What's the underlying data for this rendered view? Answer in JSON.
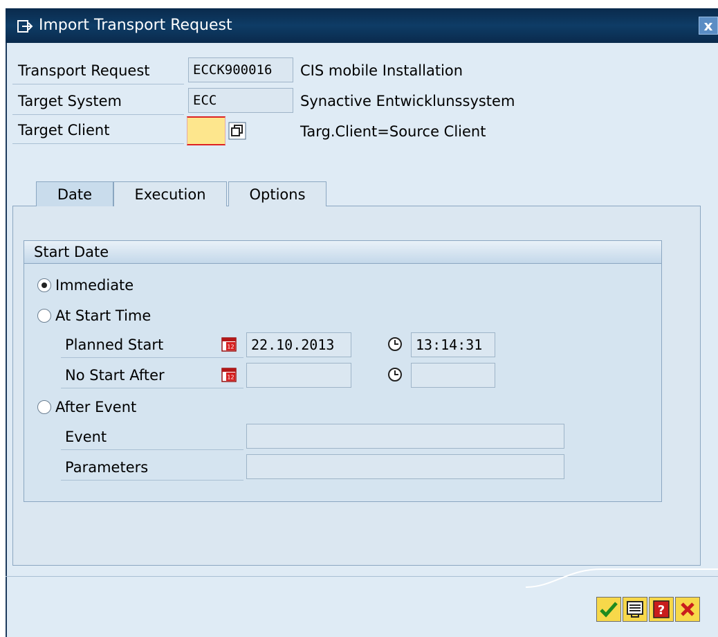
{
  "window": {
    "title": "Import Transport Request",
    "close_label": "x"
  },
  "form": {
    "transport_request": {
      "label": "Transport Request",
      "value": "ECCK900016",
      "description": "CIS mobile Installation"
    },
    "target_system": {
      "label": "Target System",
      "value": "ECC",
      "description": "Synactive Entwicklunssystem"
    },
    "target_client": {
      "label": "Target Client",
      "value": "",
      "description": "Targ.Client=Source Client"
    }
  },
  "tabs": [
    {
      "label": "Date",
      "active": true
    },
    {
      "label": "Execution",
      "active": false
    },
    {
      "label": "Options",
      "active": false
    }
  ],
  "start_date": {
    "group_title": "Start Date",
    "options": [
      {
        "label": "Immediate",
        "selected": true
      },
      {
        "label": "At Start Time",
        "selected": false
      },
      {
        "label": "After Event",
        "selected": false
      }
    ],
    "planned_start": {
      "label": "Planned Start",
      "date": "22.10.2013",
      "time": "13:14:31"
    },
    "no_start_after": {
      "label": "No Start After",
      "date": "",
      "time": ""
    },
    "event": {
      "label": "Event",
      "value": ""
    },
    "parameters": {
      "label": "Parameters",
      "value": ""
    }
  },
  "toolbar": [
    {
      "name": "continue-button",
      "icon": "checkmark-icon"
    },
    {
      "name": "display-button",
      "icon": "display-icon"
    },
    {
      "name": "help-button",
      "icon": "help-icon"
    },
    {
      "name": "cancel-button",
      "icon": "cancel-icon"
    }
  ]
}
